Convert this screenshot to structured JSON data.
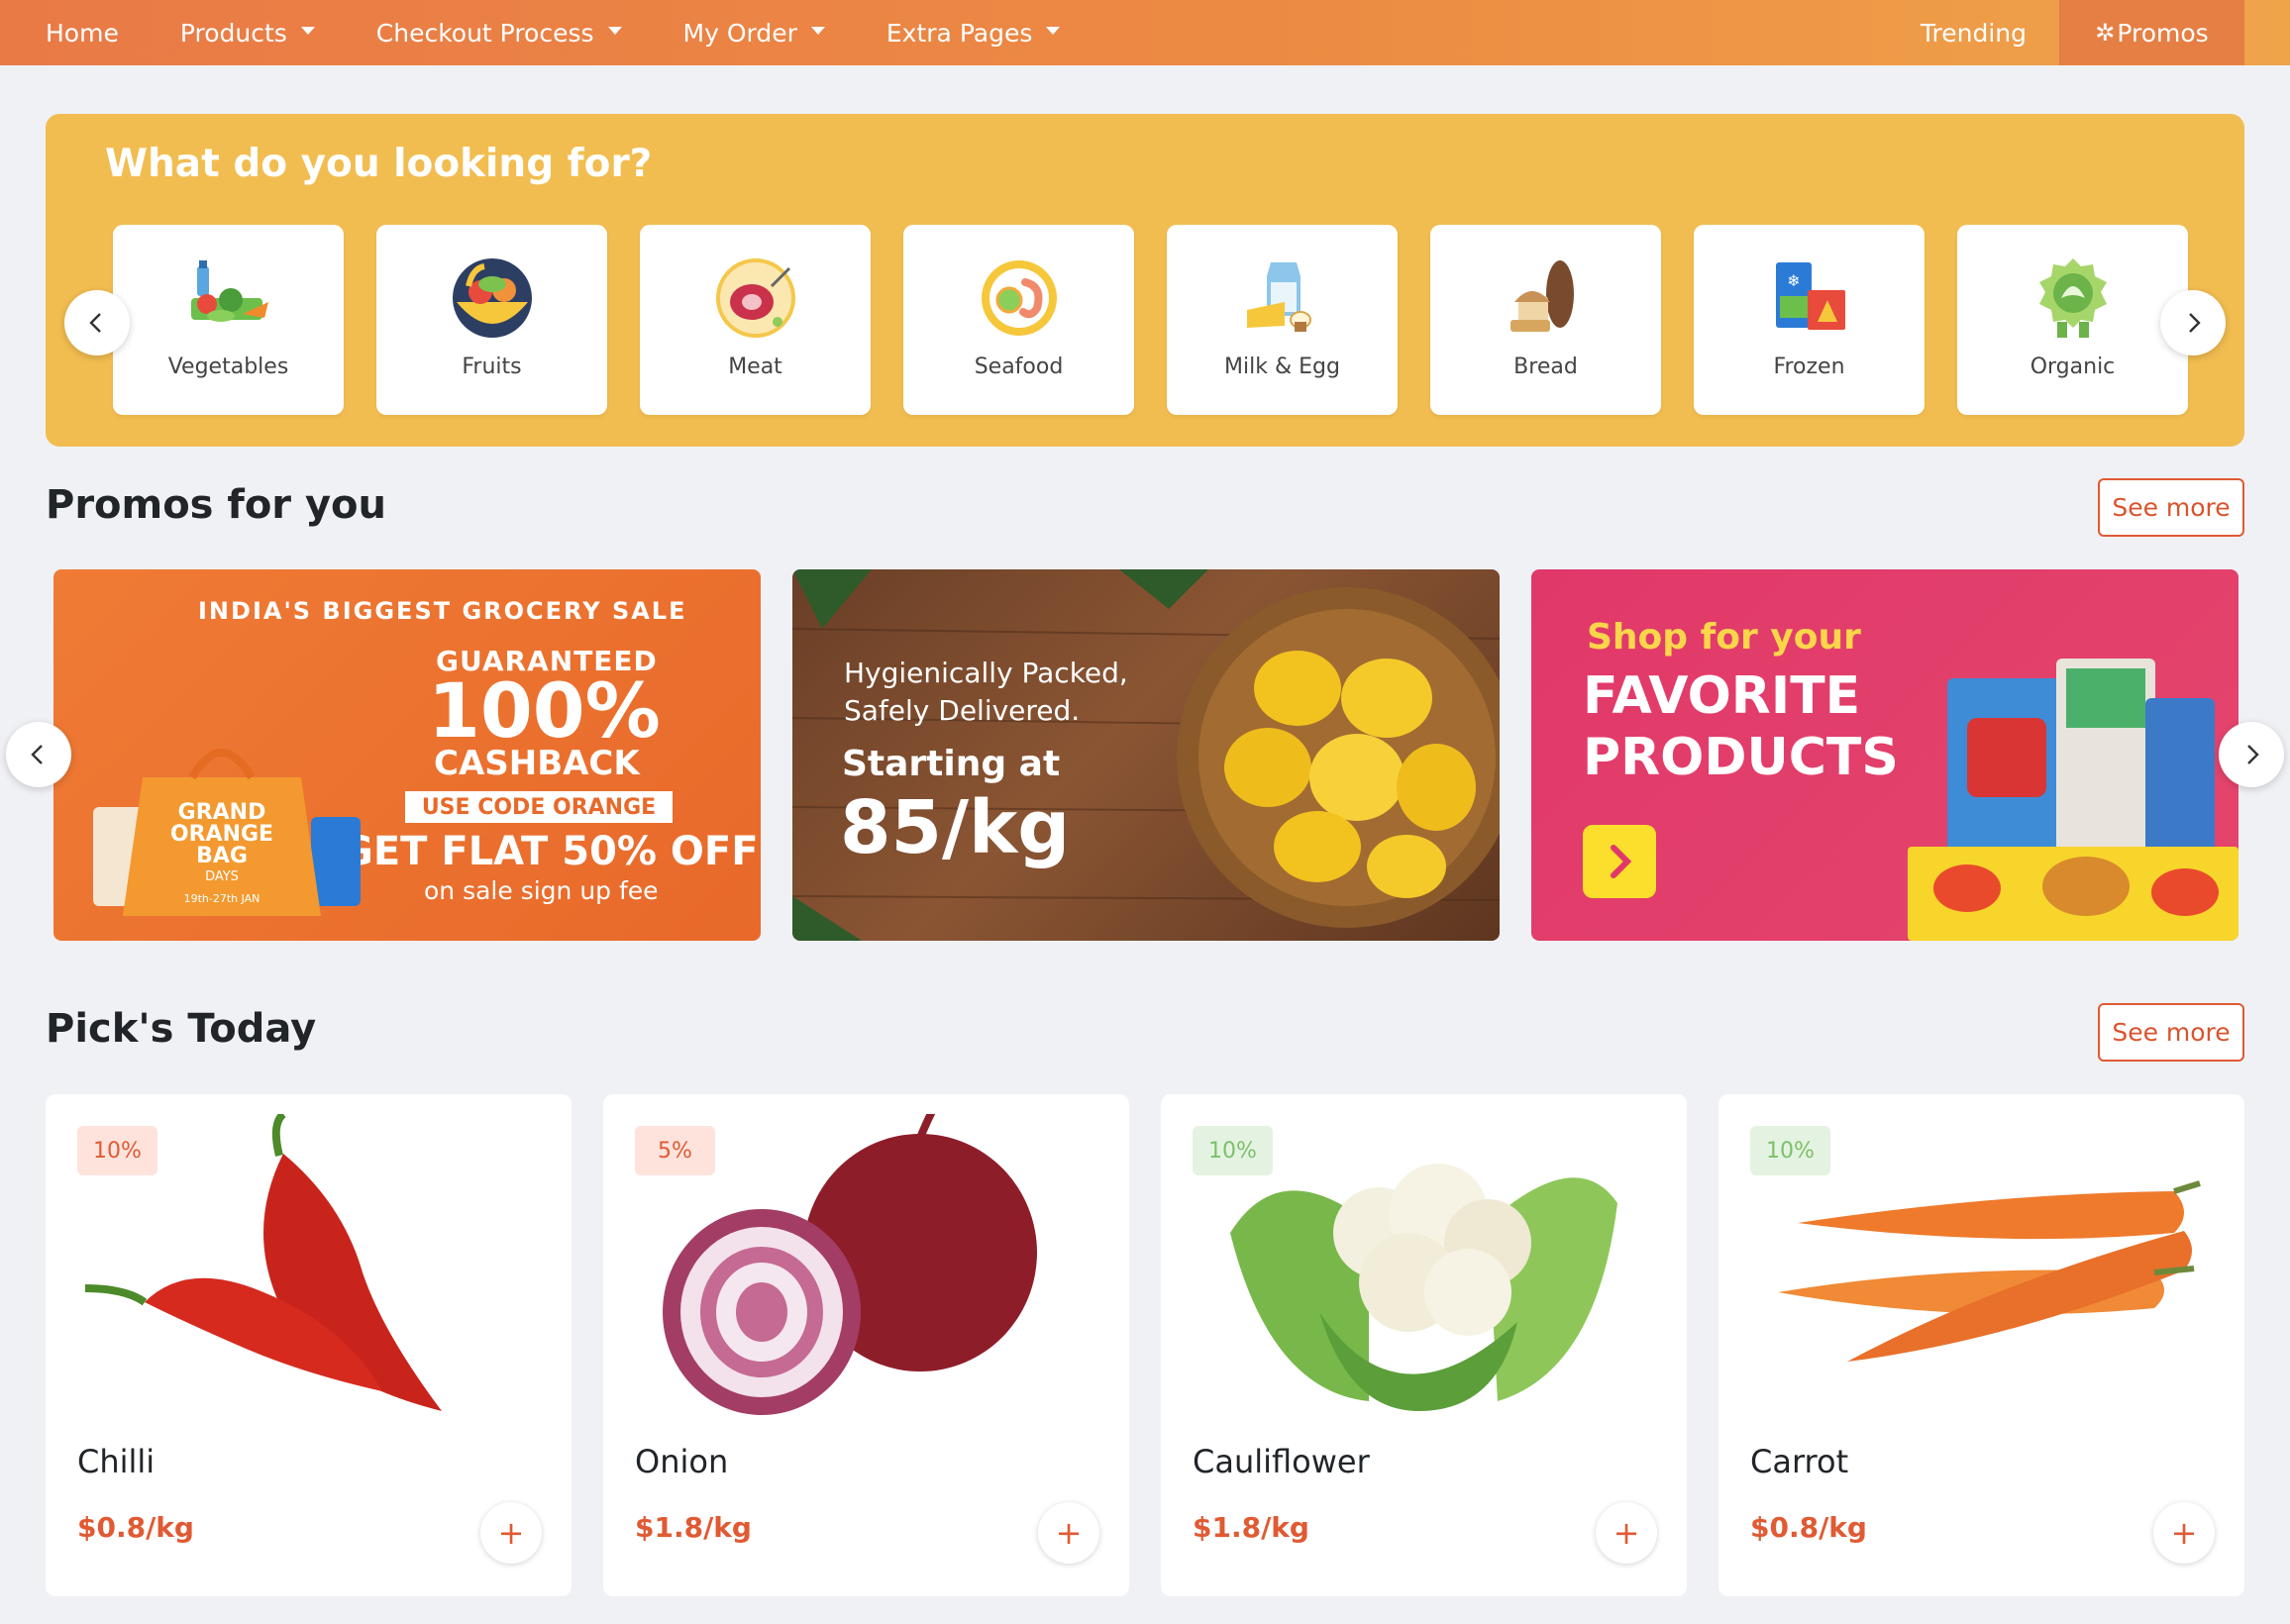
{
  "nav": {
    "items": [
      {
        "label": "Home",
        "dropdown": false
      },
      {
        "label": "Products",
        "dropdown": true
      },
      {
        "label": "Checkout Process",
        "dropdown": true
      },
      {
        "label": "My Order",
        "dropdown": true
      },
      {
        "label": "Extra Pages",
        "dropdown": true
      }
    ],
    "trending": "Trending",
    "promos": "Promos"
  },
  "categories": {
    "title": "What do you looking for?",
    "items": [
      {
        "label": "Vegetables",
        "icon": "vegetables-icon"
      },
      {
        "label": "Fruits",
        "icon": "fruits-icon"
      },
      {
        "label": "Meat",
        "icon": "meat-icon"
      },
      {
        "label": "Seafood",
        "icon": "seafood-icon"
      },
      {
        "label": "Milk & Egg",
        "icon": "milk-egg-icon"
      },
      {
        "label": "Bread",
        "icon": "bread-icon"
      },
      {
        "label": "Frozen",
        "icon": "frozen-icon"
      },
      {
        "label": "Organic",
        "icon": "organic-icon"
      }
    ]
  },
  "promos": {
    "title": "Promos for you",
    "see_more": "See more",
    "banner1": {
      "headline": "INDIA'S BIGGEST GROCERY SALE",
      "guaranteed": "GUARANTEED",
      "percent": "100%",
      "cashback": "CASHBACK",
      "code": "USE CODE ORANGE",
      "flat": "GET FLAT 50% OFF",
      "sub": "on sale sign up fee",
      "bag_l1": "GRAND",
      "bag_l2": "ORANGE",
      "bag_l3": "BAG",
      "bag_l4": "DAYS",
      "bag_l5": "19th-27th JAN"
    },
    "banner2": {
      "l1": "Hygienically Packed,",
      "l2": "Safely Delivered.",
      "l3": "Starting at",
      "l4": "85/kg"
    },
    "banner3": {
      "l1": "Shop for your",
      "l2": "FAVORITE",
      "l3": "PRODUCTS"
    }
  },
  "picks": {
    "title": "Pick's Today",
    "see_more": "See more",
    "products": [
      {
        "name": "Chilli",
        "price": "$0.8/kg",
        "discount": "10%",
        "badge_color": "red"
      },
      {
        "name": "Onion",
        "price": "$1.8/kg",
        "discount": "5%",
        "badge_color": "red"
      },
      {
        "name": "Cauliflower",
        "price": "$1.8/kg",
        "discount": "10%",
        "badge_color": "green"
      },
      {
        "name": "Carrot",
        "price": "$0.8/kg",
        "discount": "10%",
        "badge_color": "green"
      }
    ],
    "add_label": "+"
  },
  "colors": {
    "accent": "#e05a33",
    "nav_start": "#e97a46",
    "nav_end": "#efa44a",
    "category_panel": "#f2bd50"
  }
}
